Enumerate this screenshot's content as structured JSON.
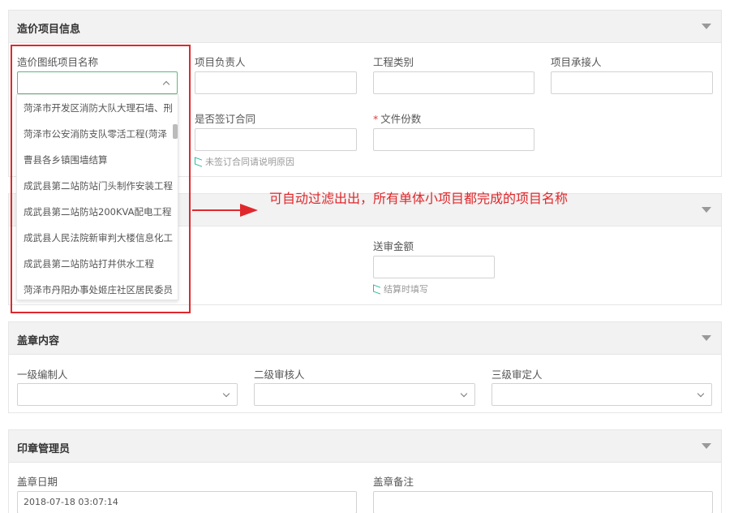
{
  "section1": {
    "title": "造价项目信息",
    "fields": {
      "drawing_project_label": "造价图纸项目名称",
      "project_lead_label": "项目负责人",
      "project_type_label": "工程类别",
      "undertaker_label": "项目承接人",
      "contract_label": "是否签订合同",
      "doc_count_label": "文件份数",
      "contract_hint": "未签订合同请说明原因"
    }
  },
  "dropdown": {
    "options": [
      "菏泽市开发区消防大队大理石墙、刑",
      "菏泽市公安消防支队零活工程(菏泽",
      "曹县各乡镇围墙结算",
      "成武县第二站防站门头制作安装工程",
      "成武县第二站防站200KVA配电工程",
      "成武县人民法院新审判大楼信息化工",
      "成武县第二站防站打井供水工程",
      "菏泽市丹阳办事处姬庄社区居民委员"
    ]
  },
  "annotation": "可自动过滤出出，所有单体小项目都完成的项目名称",
  "section2": {
    "submit_amount_label": "送审金额",
    "submit_hint": "结算时填写"
  },
  "section3": {
    "title": "盖章内容",
    "level1_label": "一级编制人",
    "level2_label": "二级审核人",
    "level3_label": "三级审定人"
  },
  "section4": {
    "title": "印章管理员",
    "seal_date_label": "盖章日期",
    "seal_date_value": "2018-07-18 03:07:14",
    "seal_note_label": "盖章备注"
  }
}
